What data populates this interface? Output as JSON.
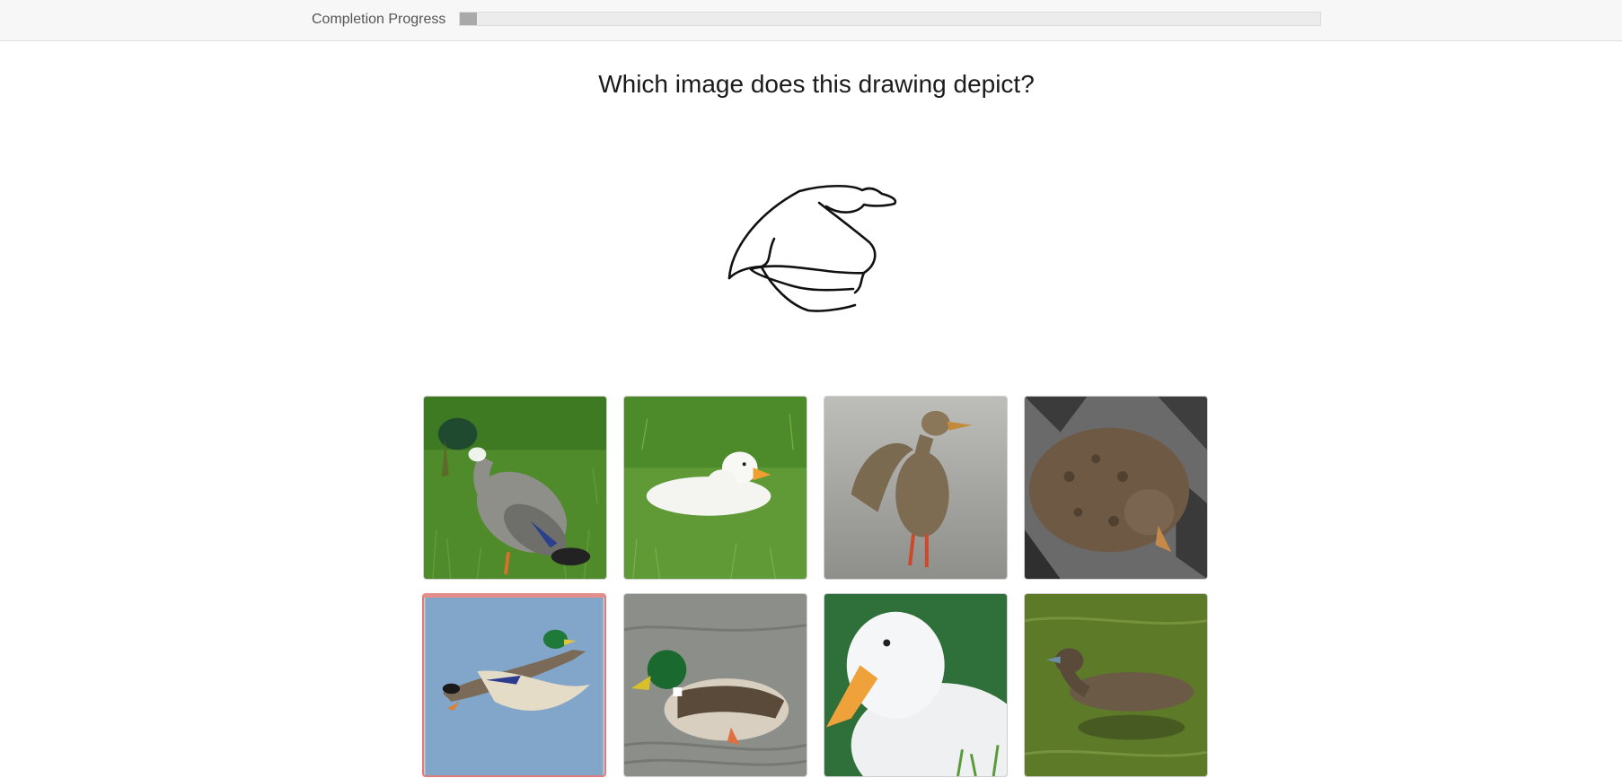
{
  "progress": {
    "label": "Completion Progress",
    "fraction": 0.02
  },
  "question": "Which image does this drawing depict?",
  "sketch_icon": "duck-sketch",
  "options": [
    {
      "subject": "mallard drake grazing on grass",
      "selected": false
    },
    {
      "subject": "white duck resting on grass",
      "selected": false
    },
    {
      "subject": "brown female mallard flapping wings",
      "selected": false
    },
    {
      "subject": "speckled duck on gray rocks",
      "selected": false
    },
    {
      "subject": "mallard drake flying in blue sky",
      "selected": true
    },
    {
      "subject": "mallard drake swimming on water",
      "selected": false
    },
    {
      "subject": "close-up of white duck head",
      "selected": false
    },
    {
      "subject": "pacific black duck swimming in green water",
      "selected": false
    }
  ],
  "colors": {
    "progress_fill": "#a9a9a9",
    "selected_border": "#e58c8c"
  }
}
